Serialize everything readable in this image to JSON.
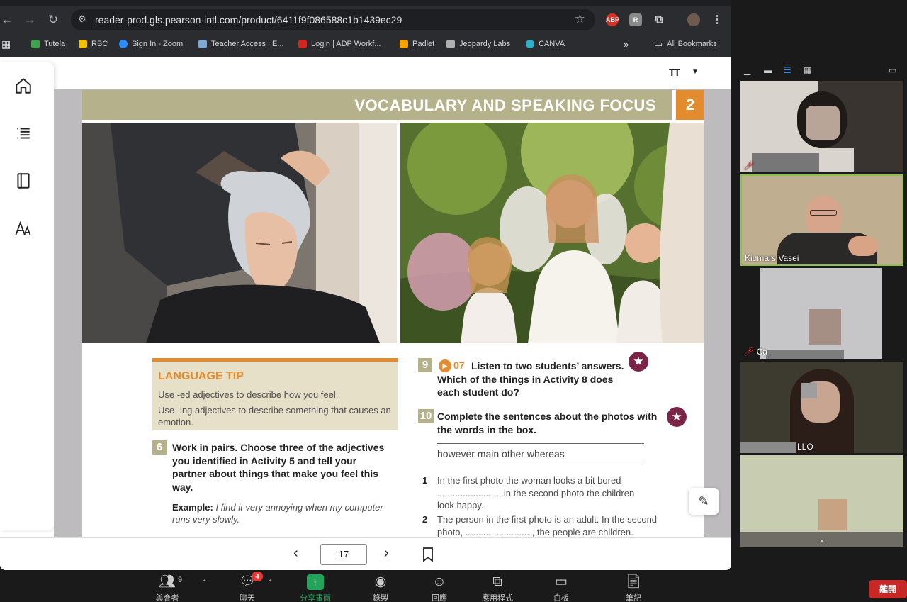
{
  "browser": {
    "url": "reader-prod.gls.pearson-intl.com/product/6411f9f086588c1b1439ec29",
    "extensions": [
      "ABP",
      "R"
    ],
    "bookmarks": [
      "Tutela",
      "RBC",
      "Sign In - Zoom",
      "Teacher Access | E...",
      "Login | ADP Workf...",
      "Padlet",
      "Jeopardy Labs",
      "CANVA"
    ],
    "bookmarks_more": "»",
    "all_bookmarks": "All Bookmarks"
  },
  "reader": {
    "font_button": "TT",
    "page_number": "17",
    "header_title": "VOCABULARY AND SPEAKING FOCUS",
    "unit_number": "2",
    "language_tip": {
      "title": "LANGUAGE TIP",
      "line1": "Use -ed adjectives to describe how you feel.",
      "line2": "Use -ing adjectives to describe something that causes an emotion."
    },
    "activity6": {
      "num": "6",
      "text": "Work in pairs. Choose three of the adjectives you identified in Activity 5 and tell your partner about things that make you feel this way.",
      "example_label": "Example:",
      "example_text": "I find it very annoying when my computer runs very slowly."
    },
    "activity9": {
      "num": "9",
      "audio": "07",
      "text": "Listen to two students’ answers. Which of the things in Activity 8 does each student do?"
    },
    "activity10": {
      "num": "10",
      "text": "Complete the sentences about the photos with the words in the box.",
      "words": "however   main   other   whereas"
    },
    "sentences": [
      {
        "num": "1",
        "text": "In the first photo the woman looks a bit bored ......................... in the second photo the children look happy."
      },
      {
        "num": "2",
        "text": "The person in the first photo is an adult. In the second photo, ......................... , the people are children."
      }
    ]
  },
  "zoom": {
    "toolbar": [
      {
        "label": "與會者",
        "icon": "participants-icon",
        "count": "9"
      },
      {
        "label": "聊天",
        "icon": "chat-icon",
        "badge": "4"
      },
      {
        "label": "分享畫面",
        "icon": "share-screen-icon"
      },
      {
        "label": "錄製",
        "icon": "record-icon"
      },
      {
        "label": "回應",
        "icon": "reactions-icon"
      },
      {
        "label": "應用程式",
        "icon": "apps-icon"
      },
      {
        "label": "白板",
        "icon": "whiteboard-icon"
      },
      {
        "label": "筆記",
        "icon": "notes-icon"
      }
    ],
    "leave": "離開",
    "participants": [
      {
        "name": ""
      },
      {
        "name": "Kiumars Vasei"
      },
      {
        "name": "Ca"
      },
      {
        "name": "LLO"
      },
      {
        "name": ""
      }
    ],
    "colors": {
      "active_speaker": "#8bc34a",
      "share": "#22a55a",
      "leave": "#c62828"
    }
  }
}
